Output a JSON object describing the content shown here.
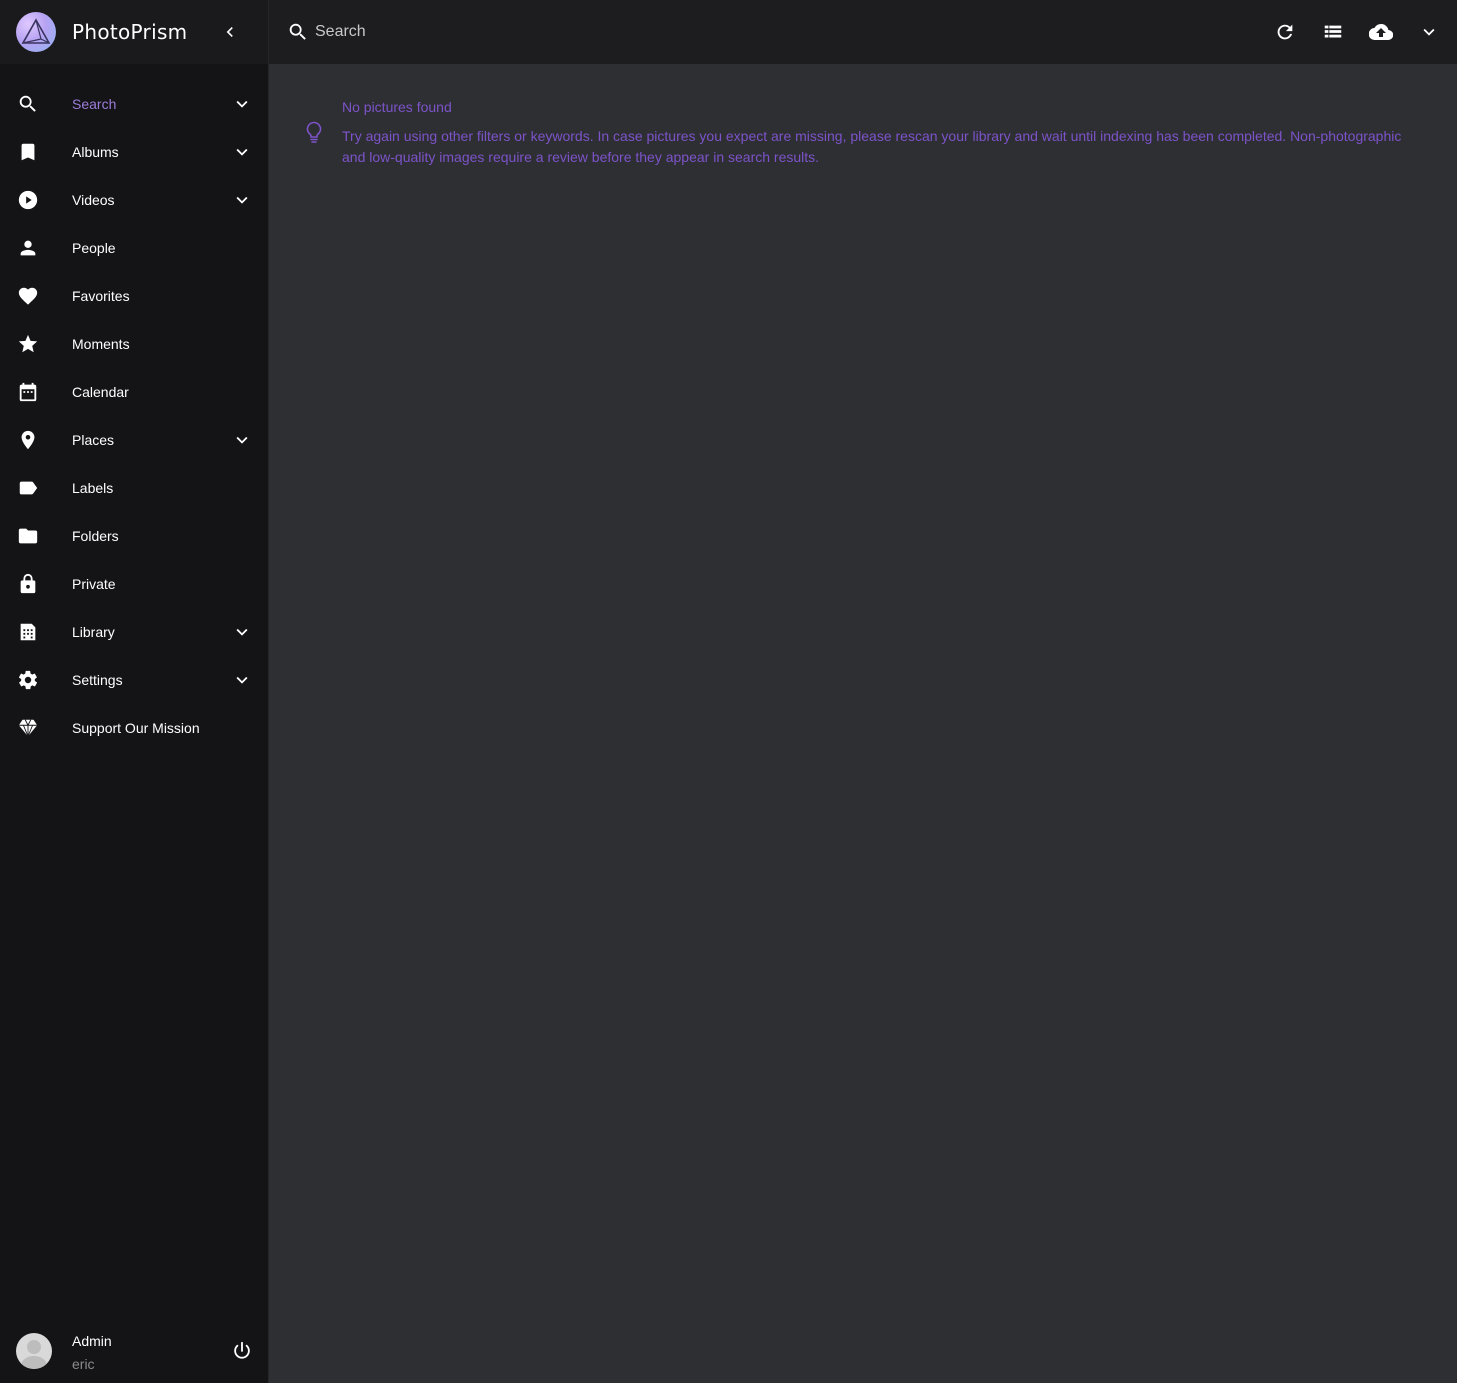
{
  "app": {
    "name": "PhotoPrism",
    "accent_color": "#7c53c9",
    "active_color": "#9b7cd9"
  },
  "sidebar": {
    "items": [
      {
        "label": "Search",
        "icon": "search-icon",
        "expandable": true,
        "active": true
      },
      {
        "label": "Albums",
        "icon": "bookmark-icon",
        "expandable": true
      },
      {
        "label": "Videos",
        "icon": "play-circle-icon",
        "expandable": true
      },
      {
        "label": "People",
        "icon": "person-icon",
        "expandable": false
      },
      {
        "label": "Favorites",
        "icon": "heart-icon",
        "expandable": false
      },
      {
        "label": "Moments",
        "icon": "star-icon",
        "expandable": false
      },
      {
        "label": "Calendar",
        "icon": "calendar-icon",
        "expandable": false
      },
      {
        "label": "Places",
        "icon": "map-pin-icon",
        "expandable": true
      },
      {
        "label": "Labels",
        "icon": "label-icon",
        "expandable": false
      },
      {
        "label": "Folders",
        "icon": "folder-icon",
        "expandable": false
      },
      {
        "label": "Private",
        "icon": "lock-icon",
        "expandable": false
      },
      {
        "label": "Library",
        "icon": "library-icon",
        "expandable": true
      },
      {
        "label": "Settings",
        "icon": "gear-icon",
        "expandable": true
      },
      {
        "label": "Support Our Mission",
        "icon": "diamond-icon",
        "expandable": false
      }
    ],
    "user": {
      "name": "Admin",
      "login": "eric"
    }
  },
  "toolbar": {
    "search_placeholder": "Search",
    "buttons": [
      "refresh-icon",
      "list-view-icon",
      "upload-icon",
      "chevron-down-icon"
    ]
  },
  "main": {
    "alert": {
      "title": "No pictures found",
      "text": "Try again using other filters or keywords. In case pictures you expect are missing, please rescan your library and wait until indexing has been completed. Non-photographic and low-quality images require a review before they appear in search results."
    }
  }
}
